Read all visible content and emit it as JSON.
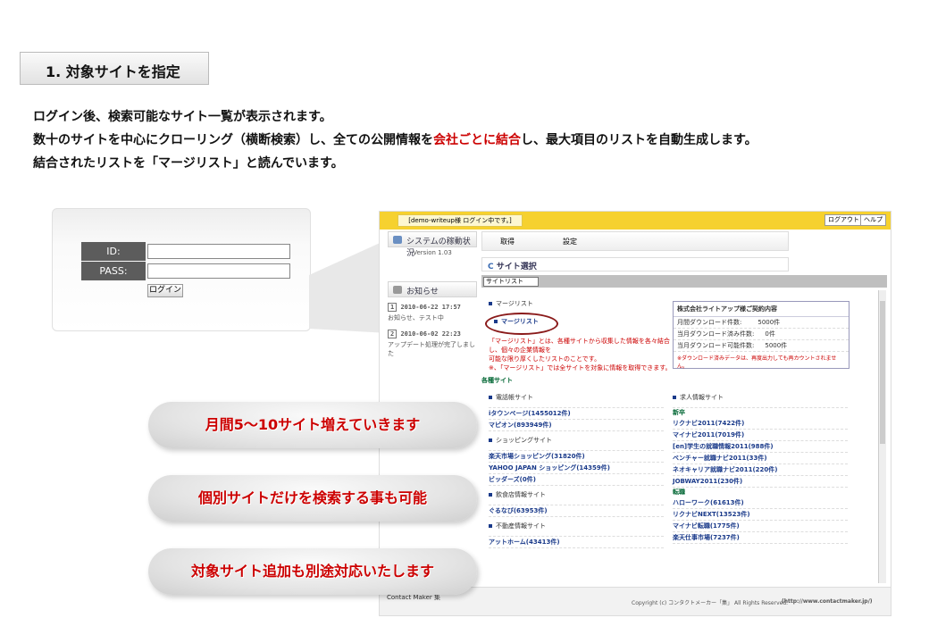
{
  "step": {
    "title": "1. 対象サイトを指定"
  },
  "intro": {
    "line1": "ログイン後、検索可能なサイト一覧が表示されます。",
    "line2_a": "数十のサイトを中心にクローリング（横断検索）し、全ての公開情報を",
    "line2_hl": "会社ごとに結合",
    "line2_b": "し、最大項目のリストを自動生成します。",
    "line3": "結合されたリストを「マージリスト」と読んでいます。"
  },
  "login": {
    "id_label": "ID:",
    "pass_label": "PASS:",
    "button": "ログイン"
  },
  "app": {
    "user_tag": "[demo-writeup様 ログイン中です。]",
    "logout": "ログアウト",
    "help": "ヘルプ",
    "side": {
      "status_title": "システムの稼動状況",
      "version": "Version 1.03",
      "news_title": "お知らせ",
      "news": [
        {
          "num": "1",
          "date": "2010-06-22 17:57",
          "text": "お知らせ、テスト中"
        },
        {
          "num": "2",
          "date": "2010-06-02 22:23",
          "text": "アップデート処理が完了しました"
        }
      ]
    },
    "nav": {
      "get": "取得",
      "settings": "設定"
    },
    "site_select": "サイト選択",
    "dropdown": "サイトリスト",
    "merge": {
      "header": "マージリスト",
      "link": "マージリスト",
      "note1": "「マージリスト」とは、各種サイトから収集した情報を各々結合し、個々の企業情報を",
      "note2": "可能な限り厚くしたリストのことです。",
      "note3": "※、「マージリスト」では全サイトを対象に情報を取得できます。"
    },
    "contract": {
      "title": "株式会社ライトアップ様ご契約内容",
      "rows": [
        {
          "label": "月間ダウンロード件数:",
          "value": "5000件"
        },
        {
          "label": "当月ダウンロード済み件数:",
          "value": "0件"
        },
        {
          "label": "当月ダウンロード可能件数:",
          "value": "5000件"
        }
      ],
      "note": "※ダウンロード済みデータは、再度出力しても再カウントされません。"
    },
    "sites_title": "各種サイト",
    "left_groups": [
      {
        "name": "電話帳サイト",
        "items": [
          "iタウンページ(1455012件)",
          "マピオン(893949件)"
        ]
      },
      {
        "name": "ショッピングサイト",
        "items": [
          "楽天市場ショッピング(31820件)",
          "YAHOO JAPAN ショッピング(14359件)",
          "ビッダーズ(0件)"
        ]
      },
      {
        "name": "飲食店情報サイト",
        "items": [
          "ぐるなび(63953件)"
        ]
      },
      {
        "name": "不動産情報サイト",
        "items": [
          "アットホーム(43413件)"
        ]
      }
    ],
    "right_title": "求人情報サイト",
    "right_groups": [
      {
        "name": "新卒",
        "items": [
          "リクナビ2011(7422件)",
          "マイナビ2011(7019件)",
          "[en]学生の就職情報2011(988件)",
          "ベンチャー就職ナビ2011(33件)",
          "ネオキャリア就職ナビ2011(220件)",
          "JOBWAY2011(230件)"
        ]
      },
      {
        "name": "転職",
        "items": [
          "ハローワーク(61613件)",
          "リクナビNEXT(13523件)",
          "マイナビ転職(1775件)",
          "楽天仕事市場(7237件)"
        ]
      }
    ],
    "footer_copy": "Copyright (c) コンタクトメーカー「集」 All Rights Reserved.",
    "footer_url": "(http://www.contactmaker.jp/)",
    "footer_logo": "Contact Maker 集"
  },
  "callouts": [
    "月間5～10サイト増えていきます",
    "個別サイトだけを検索する事も可能",
    "対象サイト追加も別途対応いたします"
  ]
}
